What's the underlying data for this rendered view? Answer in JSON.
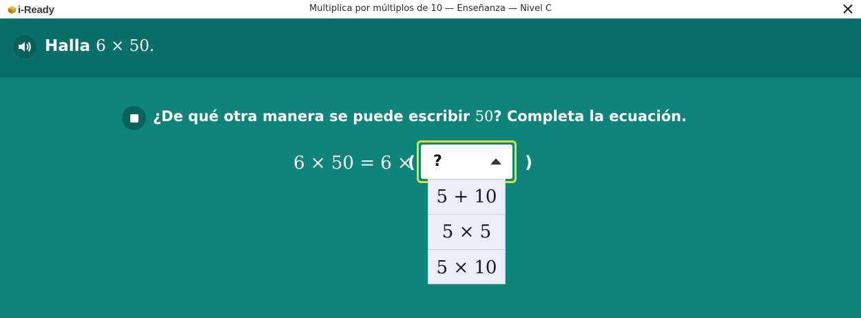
{
  "app": {
    "logo_text": "i-Ready",
    "window_title": "Multiplica por múltiplos de 10 — Enseñanza — Nivel C"
  },
  "prompt": {
    "label": "Halla",
    "math": "6 × 50."
  },
  "question": {
    "pre": "¿De qué otra manera se puede escribir ",
    "math": "50",
    "post": "? Completa la ecuación."
  },
  "equation": {
    "left": "6 × 50 = 6 ×",
    "open": "(",
    "close": ")"
  },
  "dropdown": {
    "selected": "?",
    "options": [
      "5 + 10",
      "5 × 5",
      "5 × 10"
    ]
  },
  "colors": {
    "background": "#0e847b",
    "header": "#0b6f69",
    "highlight": "#d6e436"
  },
  "icons": {
    "audio": "speaker-icon",
    "stop": "stop-icon",
    "close": "close-icon",
    "caret": "caret-up-icon"
  }
}
